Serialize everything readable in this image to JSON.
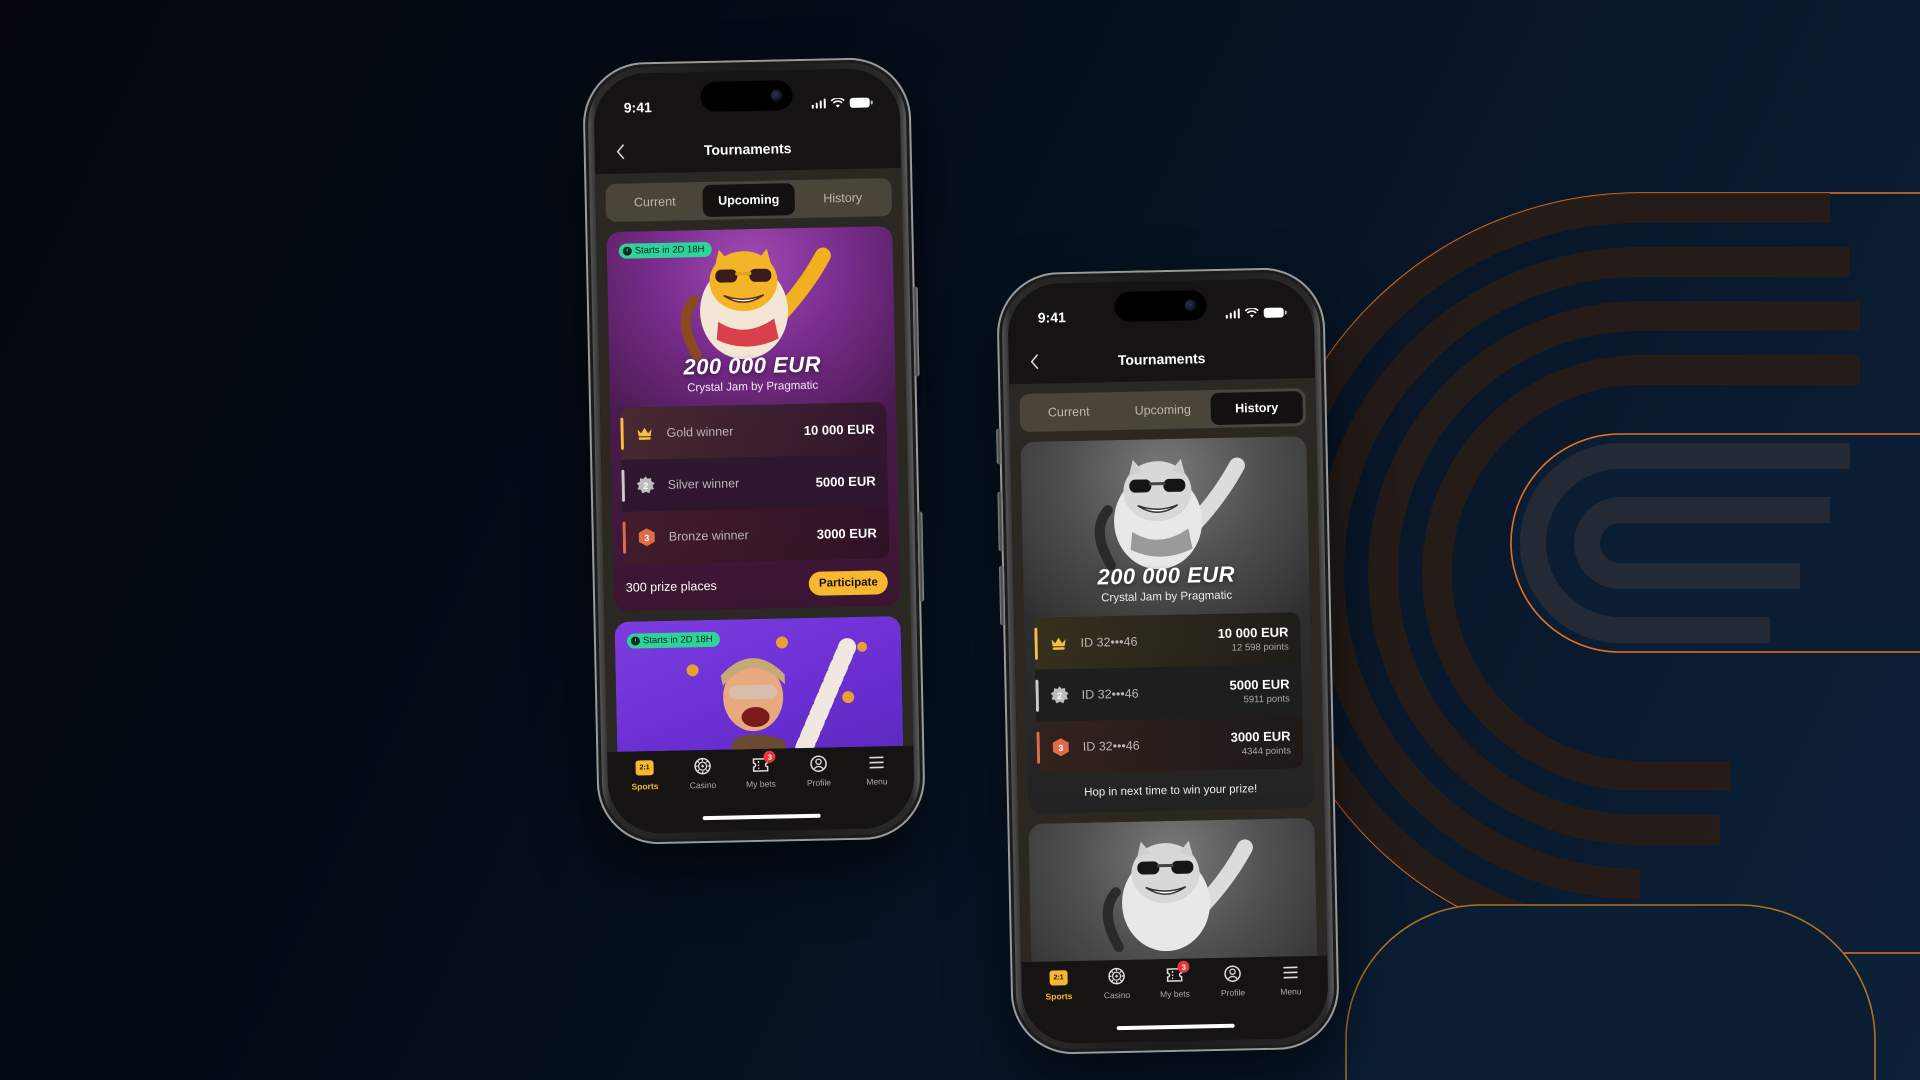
{
  "theme": {
    "accent": "#f7b731",
    "badge_green": "#2fd39a",
    "notification_red": "#e8363d",
    "gold": "#f5c140",
    "silver": "#c9c9c9",
    "bronze": "#e06b4a",
    "deco_orange": "#e8711e"
  },
  "phones": [
    {
      "status_bar": {
        "time": "9:41"
      },
      "header": {
        "title": "Tournaments"
      },
      "tabs": [
        {
          "label": "Current",
          "active": false
        },
        {
          "label": "Upcoming",
          "active": true
        },
        {
          "label": "History",
          "active": false
        }
      ],
      "cards": [
        {
          "badge": "Starts in 2D 18H",
          "mascot": "tiger-mascot",
          "prize": "200 000 EUR",
          "game": "Crystal Jam by Pragmatic",
          "winners": [
            {
              "tier": "gold",
              "medal_icon": "crown-icon",
              "label": "Gold winner",
              "amount": "10 000 EUR"
            },
            {
              "tier": "silver",
              "medal_icon": "silver-medal-icon",
              "medal_number": "2",
              "label": "Silver winner",
              "amount": "5000 EUR"
            },
            {
              "tier": "bronze",
              "medal_icon": "bronze-medal-icon",
              "medal_number": "3",
              "label": "Bronze winner",
              "amount": "3000 EUR"
            }
          ],
          "prize_places": "300 prize places",
          "cta": "Participate"
        },
        {
          "badge": "Starts in 2D 18H",
          "mascot": "robber-mascot"
        }
      ],
      "tabbar": [
        {
          "label": "Sports",
          "icon": "sports-icon",
          "icon_text": "2:1",
          "active": true
        },
        {
          "label": "Casino",
          "icon": "casino-chip-icon",
          "active": false
        },
        {
          "label": "My bets",
          "icon": "ticket-icon",
          "badge": "3",
          "active": false
        },
        {
          "label": "Profile",
          "icon": "profile-icon",
          "active": false
        },
        {
          "label": "Menu",
          "icon": "menu-icon",
          "active": false
        }
      ]
    },
    {
      "status_bar": {
        "time": "9:41"
      },
      "header": {
        "title": "Tournaments"
      },
      "tabs": [
        {
          "label": "Current",
          "active": false
        },
        {
          "label": "Upcoming",
          "active": false
        },
        {
          "label": "History",
          "active": true
        }
      ],
      "cards": [
        {
          "mascot": "tiger-mascot-grayscale",
          "prize": "200 000 EUR",
          "game": "Crystal Jam by Pragmatic",
          "winners": [
            {
              "tier": "gold",
              "medal_icon": "crown-icon",
              "label": "ID 32•••46",
              "amount": "10 000 EUR",
              "points": "12 598 points"
            },
            {
              "tier": "silver",
              "medal_icon": "silver-medal-icon",
              "medal_number": "2",
              "label": "ID 32•••46",
              "amount": "5000 EUR",
              "points": "5911 ponts"
            },
            {
              "tier": "bronze",
              "medal_icon": "bronze-medal-icon",
              "medal_number": "3",
              "label": "ID 32•••46",
              "amount": "3000 EUR",
              "points": "4344 points"
            }
          ],
          "footer_text": "Hop in next time to win your prize!"
        },
        {
          "mascot": "tiger-mascot-grayscale"
        }
      ],
      "tabbar": [
        {
          "label": "Sports",
          "icon": "sports-icon",
          "icon_text": "2:1",
          "active": true
        },
        {
          "label": "Casino",
          "icon": "casino-chip-icon",
          "active": false
        },
        {
          "label": "My bets",
          "icon": "ticket-icon",
          "badge": "3",
          "active": false
        },
        {
          "label": "Profile",
          "icon": "profile-icon",
          "active": false
        },
        {
          "label": "Menu",
          "icon": "menu-icon",
          "active": false
        }
      ]
    }
  ]
}
